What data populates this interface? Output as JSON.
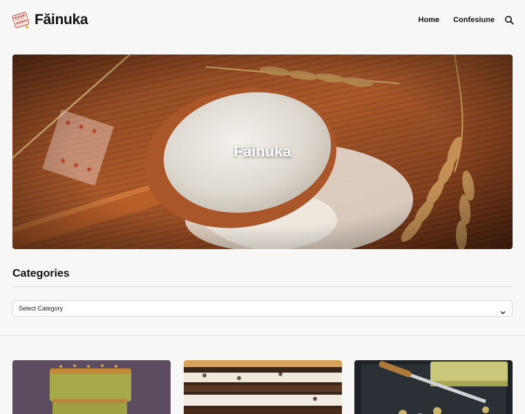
{
  "site": {
    "name": "Făinuka"
  },
  "nav": {
    "items": [
      {
        "label": "Home"
      },
      {
        "label": "Confesiune"
      }
    ],
    "search_icon": "search-icon"
  },
  "hero": {
    "title": "Făinuka",
    "image": "flour-on-wooden-spoon-with-wheat"
  },
  "categories": {
    "heading": "Categories",
    "select_value": "Select Category"
  },
  "posts": [
    {
      "image": "green-sponge-cake-slices"
    },
    {
      "image": "layered-chocolate-cream-cake"
    },
    {
      "image": "pistachio-cake-with-knife"
    }
  ],
  "colors": {
    "background": "#f7f7f7",
    "text": "#111111",
    "logo_red": "#d9443a"
  }
}
